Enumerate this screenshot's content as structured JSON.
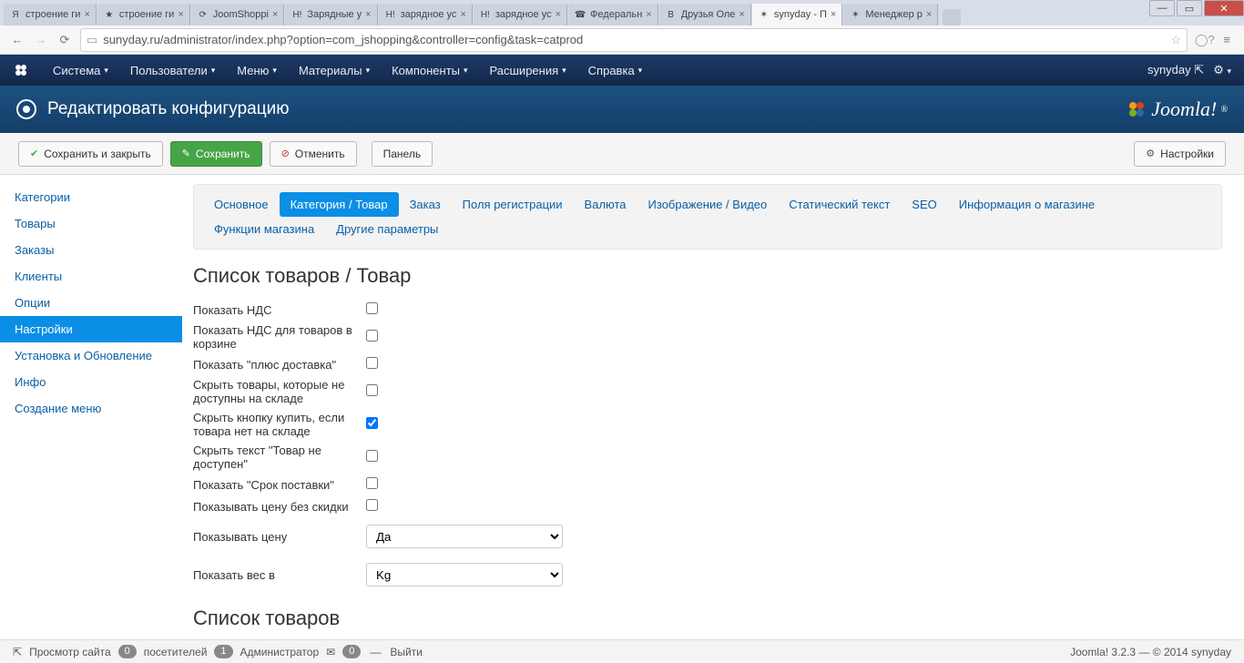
{
  "browser": {
    "tabs": [
      {
        "label": "строение ги",
        "fav": "Я"
      },
      {
        "label": "строение ги",
        "fav": "★"
      },
      {
        "label": "JoomShoppi",
        "fav": "⟳"
      },
      {
        "label": "Зарядные у",
        "fav": "H!"
      },
      {
        "label": "зарядное ус",
        "fav": "H!"
      },
      {
        "label": "зарядное ус",
        "fav": "H!"
      },
      {
        "label": "Федеральн",
        "fav": "☎"
      },
      {
        "label": "Друзья Оле",
        "fav": "B"
      },
      {
        "label": "synyday - П",
        "fav": "✶",
        "active": true
      },
      {
        "label": "Менеджер р",
        "fav": "✶"
      }
    ],
    "url": "sunyday.ru/administrator/index.php?option=com_jshopping&controller=config&task=catprod"
  },
  "jmenu": {
    "items": [
      "Система",
      "Пользователи",
      "Меню",
      "Материалы",
      "Компоненты",
      "Расширения",
      "Справка"
    ],
    "site": "synyday"
  },
  "page_title": "Редактировать конфигурацию",
  "brand": "Joomla!",
  "toolbar": {
    "save_close": "Сохранить и закрыть",
    "save": "Сохранить",
    "cancel": "Отменить",
    "panel": "Панель",
    "settings": "Настройки"
  },
  "sidebar": {
    "items": [
      "Категории",
      "Товары",
      "Заказы",
      "Клиенты",
      "Опции",
      "Настройки",
      "Установка и Обновление",
      "Инфо",
      "Создание меню"
    ],
    "active_index": 5
  },
  "navpills": {
    "items": [
      "Основное",
      "Категория / Товар",
      "Заказ",
      "Поля регистрации",
      "Валюта",
      "Изображение / Видео",
      "Статический текст",
      "SEO",
      "Информация о магазине",
      "Функции магазина",
      "Другие параметры"
    ],
    "active_index": 1
  },
  "section1": "Список товаров / Товар",
  "rows": [
    {
      "label": "Показать НДС",
      "checked": false
    },
    {
      "label": "Показать НДС для товаров в корзине",
      "checked": false
    },
    {
      "label": "Показать \"плюс доставка\"",
      "checked": false
    },
    {
      "label": "Скрыть товары, которые не доступны на складе",
      "checked": false
    },
    {
      "label": "Скрыть кнопку купить, если товара нет на складе",
      "checked": true
    },
    {
      "label": "Скрыть текст \"Товар не доступен\"",
      "checked": false
    },
    {
      "label": "Показать \"Срок поставки\"",
      "checked": false
    },
    {
      "label": "Показывать цену без скидки",
      "checked": false
    }
  ],
  "selects": [
    {
      "label": "Показывать цену",
      "value": "Да"
    },
    {
      "label": "Показать вес в",
      "value": "Kg"
    }
  ],
  "section2": "Список товаров",
  "statusbar": {
    "preview": "Просмотр сайта",
    "visitors_count": "0",
    "visitors_label": "посетителей",
    "admin_count": "1",
    "admin_label": "Администратор",
    "msg_count": "0",
    "logout": "Выйти",
    "right": "Joomla! 3.2.3 — © 2014 synyday"
  }
}
